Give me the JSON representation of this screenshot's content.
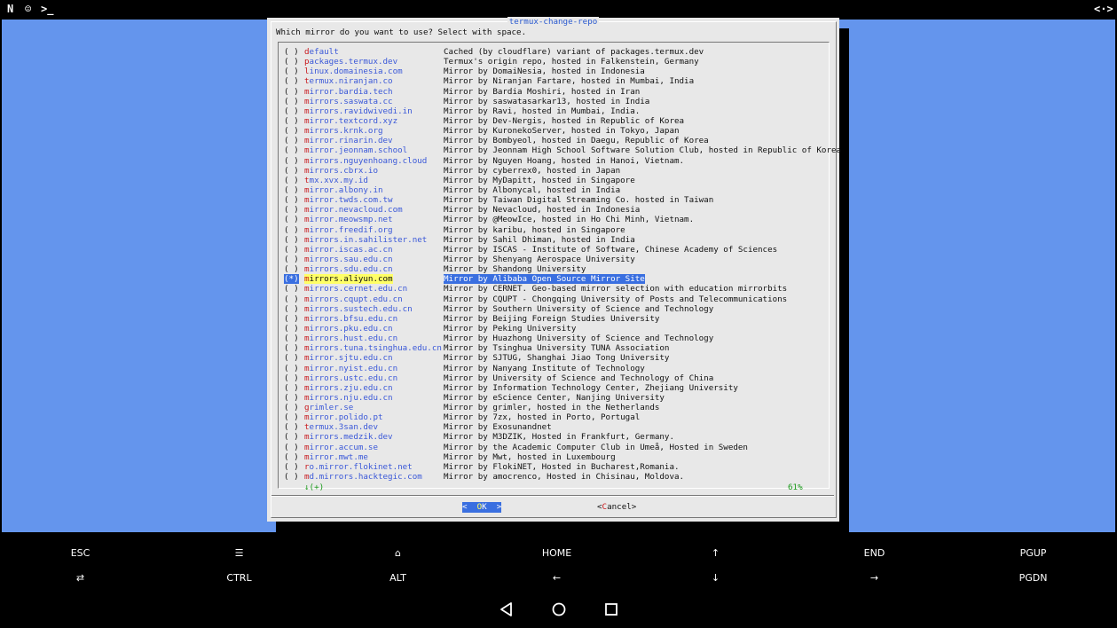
{
  "statusbar": {
    "icon1": "N",
    "icon2": "☺",
    "icon3": ">_",
    "right": "<·>"
  },
  "dialog": {
    "title": "termux-change-repo",
    "prompt": "Which mirror do you want to use? Select with space.",
    "more_indicator": "↓(+)",
    "percent": "61%",
    "ok_left": "<  ",
    "ok_hotkey": "O",
    "ok_rest": "K  >",
    "cancel_left": "<",
    "cancel_hotkey": "C",
    "cancel_rest": "ancel>"
  },
  "mirrors": [
    {
      "radio": "( )",
      "hot": "d",
      "rest": "efault",
      "desc": "Cached (by cloudflare) variant of packages.termux.dev"
    },
    {
      "radio": "( )",
      "hot": "p",
      "rest": "ackages.termux.dev",
      "desc": "Termux's origin repo, hosted in Falkenstein, Germany"
    },
    {
      "radio": "( )",
      "hot": "l",
      "rest": "inux.domainesia.com",
      "desc": "Mirror by DomaiNesia, hosted in Indonesia"
    },
    {
      "radio": "( )",
      "hot": "t",
      "rest": "ermux.niranjan.co",
      "desc": "Mirror by Niranjan Fartare, hosted in Mumbai, India"
    },
    {
      "radio": "( )",
      "hot": "m",
      "rest": "irror.bardia.tech",
      "desc": "Mirror by Bardia Moshiri, hosted in Iran"
    },
    {
      "radio": "( )",
      "hot": "m",
      "rest": "irrors.saswata.cc",
      "desc": "Mirror by saswatasarkar13, hosted in India"
    },
    {
      "radio": "( )",
      "hot": "m",
      "rest": "irrors.ravidwivedi.in",
      "desc": "Mirror by Ravi, hosted in Mumbai, India."
    },
    {
      "radio": "( )",
      "hot": "m",
      "rest": "irror.textcord.xyz",
      "desc": "Mirror by Dev-Nergis, hosted in Republic of Korea"
    },
    {
      "radio": "( )",
      "hot": "m",
      "rest": "irrors.krnk.org",
      "desc": "Mirror by KuronekoServer, hosted in Tokyo, Japan"
    },
    {
      "radio": "( )",
      "hot": "m",
      "rest": "irror.rinarin.dev",
      "desc": "Mirror by Bombyeol, hosted in Daegu, Republic of Korea"
    },
    {
      "radio": "( )",
      "hot": "m",
      "rest": "irror.jeonnam.school",
      "desc": "Mirror by Jeonnam High School Software Solution Club, hosted in Republic of Korea"
    },
    {
      "radio": "( )",
      "hot": "m",
      "rest": "irrors.nguyenhoang.cloud",
      "desc": "Mirror by Nguyen Hoang, hosted in Hanoi, Vietnam."
    },
    {
      "radio": "( )",
      "hot": "m",
      "rest": "irrors.cbrx.io",
      "desc": "Mirror by cyberrex0, hosted in Japan"
    },
    {
      "radio": "( )",
      "hot": "t",
      "rest": "mx.xvx.my.id",
      "desc": "Mirror by MyDapitt, hosted in Singapore"
    },
    {
      "radio": "( )",
      "hot": "m",
      "rest": "irror.albony.in",
      "desc": "Mirror by Albonycal, hosted in India"
    },
    {
      "radio": "( )",
      "hot": "m",
      "rest": "irror.twds.com.tw",
      "desc": "Mirror by Taiwan Digital Streaming Co. hosted in Taiwan"
    },
    {
      "radio": "( )",
      "hot": "m",
      "rest": "irror.nevacloud.com",
      "desc": "Mirror by Nevacloud, hosted in Indonesia"
    },
    {
      "radio": "( )",
      "hot": "m",
      "rest": "irror.meowsmp.net",
      "desc": "Mirror by @MeowIce, hosted in Ho Chi Minh, Vietnam."
    },
    {
      "radio": "( )",
      "hot": "m",
      "rest": "irror.freedif.org",
      "desc": "Mirror by karibu, hosted in Singapore"
    },
    {
      "radio": "( )",
      "hot": "m",
      "rest": "irrors.in.sahilister.net",
      "desc": "Mirror by Sahil Dhiman, hosted in India"
    },
    {
      "radio": "( )",
      "hot": "m",
      "rest": "irror.iscas.ac.cn",
      "desc": "Mirror by ISCAS - Institute of Software, Chinese Academy of Sciences"
    },
    {
      "radio": "( )",
      "hot": "m",
      "rest": "irrors.sau.edu.cn",
      "desc": "Mirror by Shenyang Aerospace University"
    },
    {
      "radio": "( )",
      "hot": "m",
      "rest": "irrors.sdu.edu.cn",
      "desc": "Mirror by Shandong University"
    },
    {
      "radio": "(*)",
      "hot": "m",
      "rest": "irrors.aliyun.com",
      "desc": "Mirror by Alibaba Open Source Mirror Site",
      "selected": true
    },
    {
      "radio": "( )",
      "hot": "m",
      "rest": "irrors.cernet.edu.cn",
      "desc": "Mirror by CERNET. Geo-based mirror selection with education mirrorbits"
    },
    {
      "radio": "( )",
      "hot": "m",
      "rest": "irrors.cqupt.edu.cn",
      "desc": "Mirror by CQUPT - Chongqing University of Posts and Telecommunications"
    },
    {
      "radio": "( )",
      "hot": "m",
      "rest": "irrors.sustech.edu.cn",
      "desc": "Mirror by Southern University of Science and Technology"
    },
    {
      "radio": "( )",
      "hot": "m",
      "rest": "irrors.bfsu.edu.cn",
      "desc": "Mirror by Beijing Foreign Studies University"
    },
    {
      "radio": "( )",
      "hot": "m",
      "rest": "irrors.pku.edu.cn",
      "desc": "Mirror by Peking University"
    },
    {
      "radio": "( )",
      "hot": "m",
      "rest": "irrors.hust.edu.cn",
      "desc": "Mirror by Huazhong University of Science and Technology"
    },
    {
      "radio": "( )",
      "hot": "m",
      "rest": "irrors.tuna.tsinghua.edu.cn",
      "desc": "Mirror by Tsinghua University TUNA Association"
    },
    {
      "radio": "( )",
      "hot": "m",
      "rest": "irror.sjtu.edu.cn",
      "desc": "Mirror by SJTUG, Shanghai Jiao Tong University"
    },
    {
      "radio": "( )",
      "hot": "m",
      "rest": "irror.nyist.edu.cn",
      "desc": "Mirror by Nanyang Institute of Technology"
    },
    {
      "radio": "( )",
      "hot": "m",
      "rest": "irrors.ustc.edu.cn",
      "desc": "Mirror by University of Science and Technology of China"
    },
    {
      "radio": "( )",
      "hot": "m",
      "rest": "irrors.zju.edu.cn",
      "desc": "Mirror by Information Technology Center, Zhejiang University"
    },
    {
      "radio": "( )",
      "hot": "m",
      "rest": "irrors.nju.edu.cn",
      "desc": "Mirror by eScience Center, Nanjing University"
    },
    {
      "radio": "( )",
      "hot": "g",
      "rest": "rimler.se",
      "desc": "Mirror by grimler, hosted in the Netherlands"
    },
    {
      "radio": "( )",
      "hot": "m",
      "rest": "irror.polido.pt",
      "desc": "Mirror by 7zx, hosted in Porto, Portugal"
    },
    {
      "radio": "( )",
      "hot": "t",
      "rest": "ermux.3san.dev",
      "desc": "Mirror by Exosunandnet"
    },
    {
      "radio": "( )",
      "hot": "m",
      "rest": "irrors.medzik.dev",
      "desc": "Mirror by M3DZIK, Hosted in Frankfurt, Germany."
    },
    {
      "radio": "( )",
      "hot": "m",
      "rest": "irror.accum.se",
      "desc": "Mirror by the Academic Computer Club in Umeå, Hosted in Sweden"
    },
    {
      "radio": "( )",
      "hot": "m",
      "rest": "irror.mwt.me",
      "desc": "Mirror by Mwt, hosted in Luxembourg"
    },
    {
      "radio": "( )",
      "hot": "r",
      "rest": "o.mirror.flokinet.net",
      "desc": "Mirror by FlokiNET, Hosted in Bucharest,Romania."
    },
    {
      "radio": "( )",
      "hot": "m",
      "rest": "d.mirrors.hacktegic.com",
      "desc": "Mirror by amocrenco, Hosted in Chisinau, Moldova."
    }
  ],
  "extrakeys": {
    "row1": [
      "ESC",
      "☰",
      "⌂",
      "HOME",
      "↑",
      "END",
      "PGUP"
    ],
    "row2": [
      "⇄",
      "CTRL",
      "ALT",
      "←",
      "↓",
      "→",
      "PGDN"
    ],
    "row1_names": [
      "esc-key",
      "menu-key",
      "home-symbol-key",
      "home-key",
      "up-arrow-key",
      "end-key",
      "pgup-key"
    ],
    "row2_names": [
      "tab-key",
      "ctrl-key",
      "alt-key",
      "left-arrow-key",
      "down-arrow-key",
      "right-arrow-key",
      "pgdn-key"
    ]
  },
  "navbar": {
    "back": "back-icon",
    "home": "home-circle-icon",
    "recents": "recents-square-icon"
  },
  "colors": {
    "terminal_bg": "#6495ed",
    "dialog_bg": "#e8e8e8",
    "tag_color": "#3a58d8",
    "hotkey": "#c8181c",
    "selection": "#3a6fe0",
    "selection_tag": "#ffff66",
    "indicator": "#1a9a1a"
  }
}
